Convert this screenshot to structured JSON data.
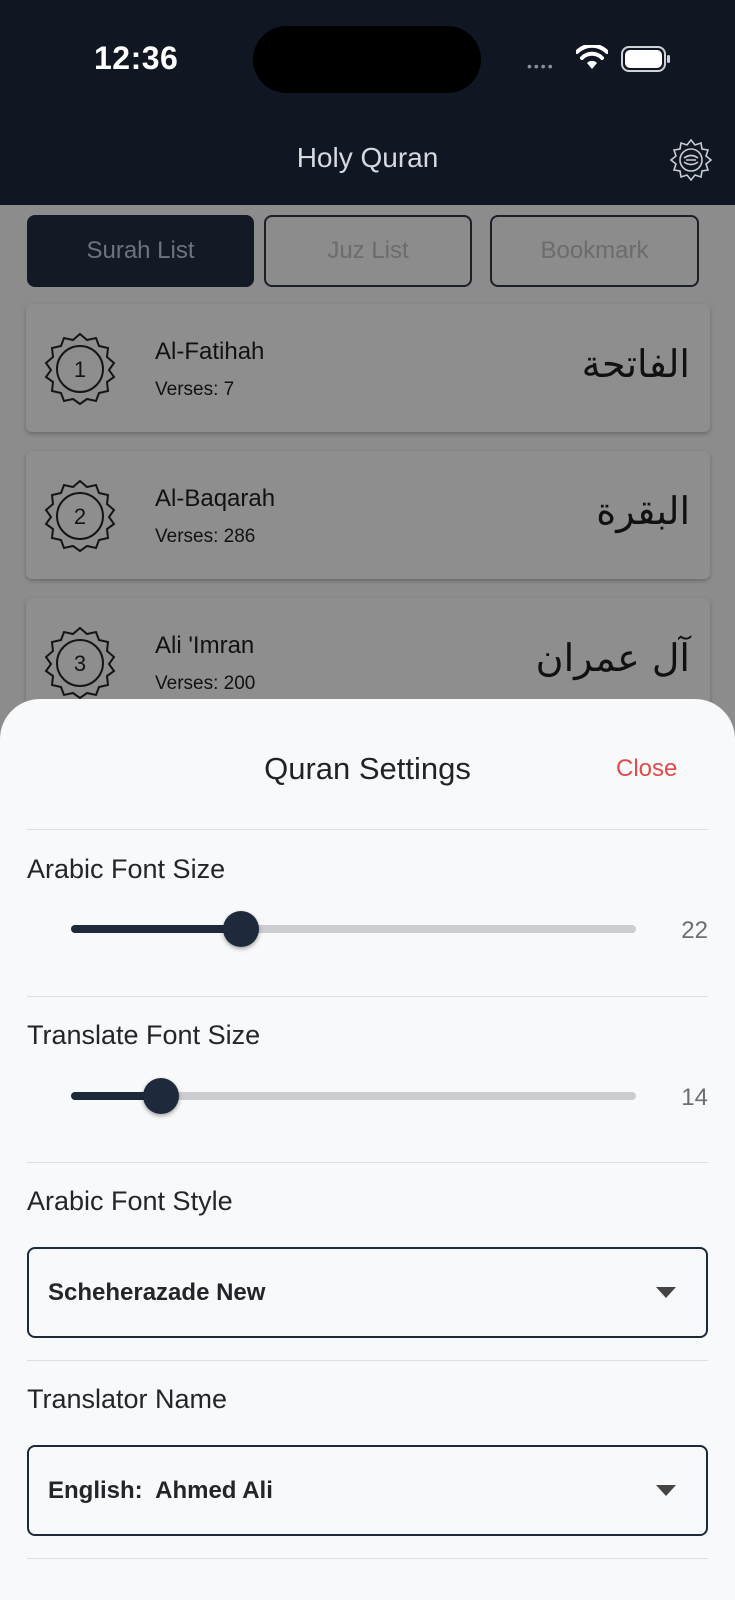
{
  "status_bar": {
    "time": "12:36",
    "dots": "••••"
  },
  "header": {
    "title": "Holy Quran"
  },
  "tabs": [
    {
      "label": "Surah List",
      "active": true
    },
    {
      "label": "Juz List",
      "active": false
    },
    {
      "label": "Bookmark",
      "active": false
    }
  ],
  "surahs": [
    {
      "number": "1",
      "name": "Al-Fatihah",
      "verses": "Verses: 7",
      "arabic": "الفاتحة"
    },
    {
      "number": "2",
      "name": "Al-Baqarah",
      "verses": "Verses: 286",
      "arabic": "البقرة"
    },
    {
      "number": "3",
      "name": "Ali 'Imran",
      "verses": "Verses: 200",
      "arabic": "آل عمران"
    }
  ],
  "settings": {
    "title": "Quran Settings",
    "close_label": "Close",
    "arabic_font_size": {
      "label": "Arabic Font Size",
      "value": "22",
      "fraction": 0.3
    },
    "translate_font_size": {
      "label": "Translate Font Size",
      "value": "14",
      "fraction": 0.16
    },
    "arabic_font_style": {
      "label": "Arabic Font Style",
      "selected": "Scheherazade New"
    },
    "translator_name": {
      "label": "Translator Name",
      "selected": "English:  Ahmed Ali"
    }
  },
  "colors": {
    "header_bg": "#111722",
    "accent": "#1e2a3c",
    "close": "#e04b4b",
    "sheet_bg": "#f8f9fa"
  }
}
